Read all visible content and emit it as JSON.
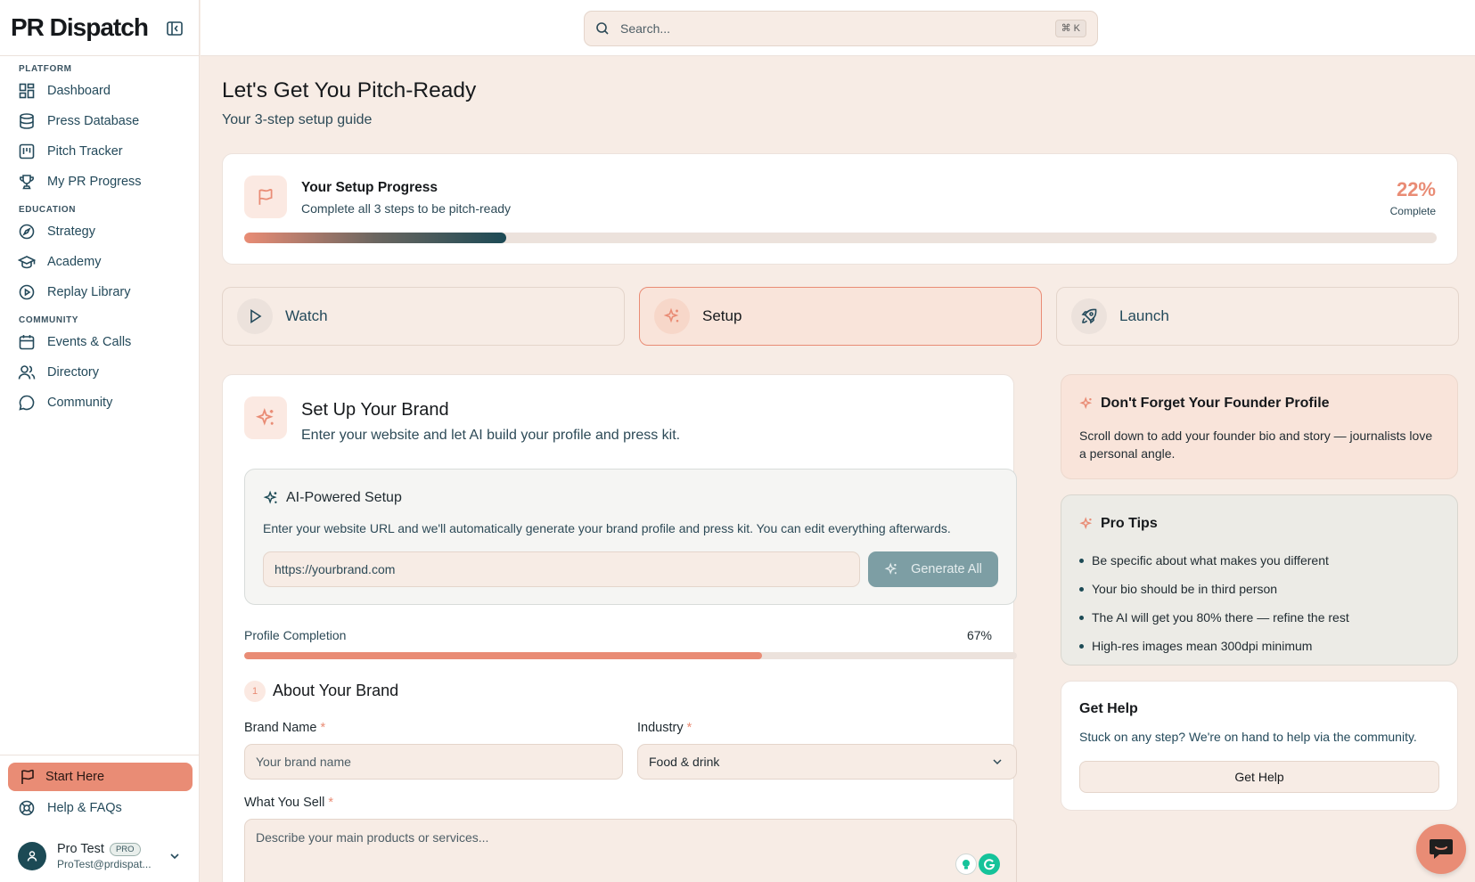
{
  "brand": {
    "logo": "PR Dispatch",
    "accent": "#e98c75",
    "dark": "#1c4a55"
  },
  "search": {
    "placeholder": "Search...",
    "shortcut": "⌘ K"
  },
  "sidebar": {
    "sections": [
      {
        "label": "PLATFORM",
        "items": [
          {
            "label": "Dashboard",
            "icon": "dashboard-icon"
          },
          {
            "label": "Press Database",
            "icon": "database-icon"
          },
          {
            "label": "Pitch Tracker",
            "icon": "kanban-icon"
          },
          {
            "label": "My PR Progress",
            "icon": "trophy-icon"
          }
        ]
      },
      {
        "label": "EDUCATION",
        "items": [
          {
            "label": "Strategy",
            "icon": "compass-icon"
          },
          {
            "label": "Academy",
            "icon": "graduation-cap-icon"
          },
          {
            "label": "Replay Library",
            "icon": "play-circle-icon"
          }
        ]
      },
      {
        "label": "COMMUNITY",
        "items": [
          {
            "label": "Events & Calls",
            "icon": "calendar-icon"
          },
          {
            "label": "Directory",
            "icon": "users-icon"
          },
          {
            "label": "Community",
            "icon": "chat-bubble-icon"
          }
        ]
      }
    ],
    "start_here": "Start Here",
    "help": "Help & FAQs",
    "user": {
      "name": "Pro Test",
      "badge": "PRO",
      "email": "ProTest@prdispat..."
    }
  },
  "page": {
    "title": "Let's Get You Pitch-Ready",
    "subtitle": "Your 3-step setup guide"
  },
  "progress": {
    "title": "Your Setup Progress",
    "subtitle": "Complete all 3 steps to be pitch-ready",
    "percent_label": "22%",
    "percent_value": 22,
    "complete_label": "Complete"
  },
  "steps": [
    {
      "label": "Watch",
      "icon": "play-icon",
      "active": false
    },
    {
      "label": "Setup",
      "icon": "sparkles-icon",
      "active": true
    },
    {
      "label": "Launch",
      "icon": "rocket-icon",
      "active": false
    }
  ],
  "brand_setup": {
    "title": "Set Up Your Brand",
    "subtitle": "Enter your website and let AI build your profile and press kit.",
    "ai": {
      "title": "AI-Powered Setup",
      "description": "Enter your website URL and we'll automatically generate your brand profile and press kit. You can edit everything afterwards.",
      "url_placeholder": "https://yourbrand.com",
      "button": "Generate All"
    },
    "completion": {
      "label": "Profile Completion",
      "percent_label": "67%",
      "percent_value": 67
    },
    "section": {
      "number": "1",
      "title": "About Your Brand"
    },
    "fields": {
      "brand_name": {
        "label": "Brand Name",
        "required": "*",
        "placeholder": "Your brand name"
      },
      "industry": {
        "label": "Industry",
        "required": "*",
        "value": "Food & drink"
      },
      "what_you_sell": {
        "label": "What You Sell",
        "required": "*",
        "placeholder": "Describe your main products or services..."
      }
    }
  },
  "founder_card": {
    "title": "Don't Forget Your Founder Profile",
    "body": "Scroll down to add your founder bio and story — journalists love a personal angle."
  },
  "pro_tips": {
    "title": "Pro Tips",
    "items": [
      "Be specific about what makes you different",
      "Your bio should be in third person",
      "The AI will get you 80% there — refine the rest",
      "High-res images mean 300dpi minimum"
    ]
  },
  "get_help": {
    "title": "Get Help",
    "body": "Stuck on any step? We're on hand to help via the community.",
    "button": "Get Help"
  }
}
